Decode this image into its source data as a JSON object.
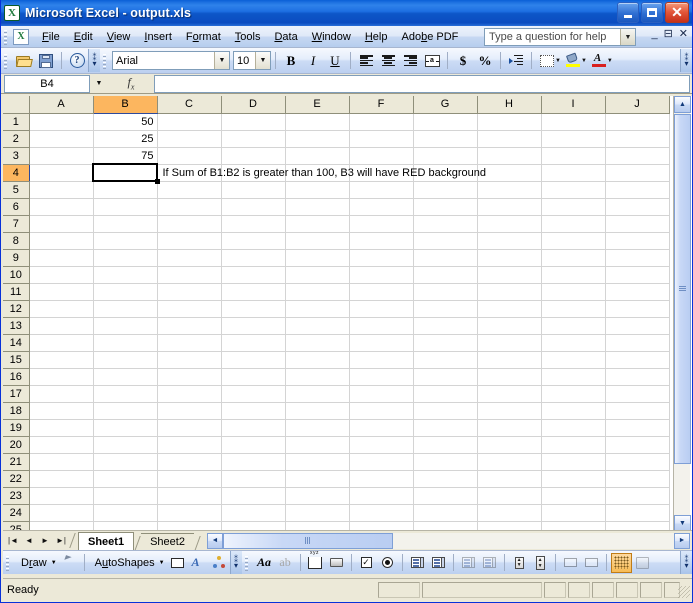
{
  "window": {
    "title": "Microsoft Excel - output.xls",
    "app_icon": "excel-icon",
    "minimize_label": "_",
    "maximize_label": "□",
    "close_label": "✕"
  },
  "menubar": {
    "items": [
      {
        "label": "File",
        "accel": "F"
      },
      {
        "label": "Edit",
        "accel": "E"
      },
      {
        "label": "View",
        "accel": "V"
      },
      {
        "label": "Insert",
        "accel": "I"
      },
      {
        "label": "Format",
        "accel": "o"
      },
      {
        "label": "Tools",
        "accel": "T"
      },
      {
        "label": "Data",
        "accel": "D"
      },
      {
        "label": "Window",
        "accel": "W"
      },
      {
        "label": "Help",
        "accel": "H"
      },
      {
        "label": "Adobe PDF",
        "accel": "b"
      }
    ],
    "ask_box_placeholder": "Type a question for help",
    "doc_minimize": "_",
    "doc_restore": "⊟",
    "doc_close": "✕"
  },
  "toolbar": {
    "open_title": "Open",
    "save_title": "Save",
    "help_title": "Microsoft Excel Help",
    "help_glyph": "?",
    "font_name": "Arial",
    "font_size": "10",
    "bold_label": "B",
    "italic_label": "I",
    "underline_label": "U",
    "align_left_title": "Align Left",
    "align_center_title": "Center",
    "align_right_title": "Align Right",
    "merge_title": "Merge and Center",
    "merge_glyph": "a",
    "currency_label": "$",
    "percent_label": "%",
    "indent_title": "Increase Indent",
    "borders_title": "Borders",
    "fill_color_title": "Fill Color",
    "fill_color": "#ffff00",
    "font_color_title": "Font Color",
    "font_color": "#d81f1f",
    "overflow_label": "»"
  },
  "formulabar": {
    "name_box_value": "B4",
    "fx_label": "fx",
    "formula_value": ""
  },
  "grid": {
    "columns": [
      "A",
      "B",
      "C",
      "D",
      "E",
      "F",
      "G",
      "H",
      "I",
      "J"
    ],
    "selected_column": "B",
    "rows": [
      "1",
      "2",
      "3",
      "4",
      "5",
      "6",
      "7",
      "8",
      "9",
      "10",
      "11",
      "12",
      "13",
      "14",
      "15",
      "16",
      "17",
      "18",
      "19",
      "20",
      "21",
      "22",
      "23",
      "24",
      "25"
    ],
    "selected_row": "4",
    "selected_cell": "B4",
    "cells": [
      {
        "ref": "B1",
        "row": 1,
        "col": "B",
        "value": "50",
        "align": "right"
      },
      {
        "ref": "B2",
        "row": 2,
        "col": "B",
        "value": "25",
        "align": "right"
      },
      {
        "ref": "B3",
        "row": 3,
        "col": "B",
        "value": "75",
        "align": "right"
      },
      {
        "ref": "C4",
        "row": 4,
        "col": "C",
        "value": "If Sum of B1:B2 is greater than 100, B3 will have RED background",
        "align": "left"
      }
    ],
    "header_selected_color": "#fcb65f"
  },
  "scrollbars": {
    "v_up": "▲",
    "v_down": "▼",
    "h_left": "◄",
    "h_right": "►"
  },
  "sheettabs": {
    "nav_first": "|◄",
    "nav_prev": "◄",
    "nav_next": "►",
    "nav_last": "►|",
    "tabs": [
      {
        "label": "Sheet1",
        "active": true
      },
      {
        "label": "Sheet2",
        "active": false
      }
    ]
  },
  "drawing_toolbar": {
    "draw_label": "Draw",
    "draw_arrow": "▼",
    "select_objects_title": "Select Objects",
    "autoshapes_label": "AutoShapes",
    "autoshapes_accel": "u",
    "autoshapes_arrow": "▼",
    "rectangle_title": "Rectangle",
    "wordart_title": "Insert WordArt",
    "wordart_glyph": "A",
    "diagram_title": "Insert Diagram or Organization Chart",
    "overflow_label": "»"
  },
  "control_toolbox": {
    "design_mode_title": "Design Mode",
    "design_glyph": "Aa",
    "properties_title": "Properties",
    "properties_glyph": "ab",
    "view_code_title": "View Code",
    "view_code_glyph": "xyz",
    "checkbox_title": "Check Box",
    "checkbox_glyph": "✓",
    "optionbutton_title": "Option Button",
    "textbox_title": "Text Box",
    "combobox_title": "Combo Box",
    "listbox_title": "List Box",
    "togglebutton_title": "Toggle Button",
    "spinbutton_title": "Spin Button",
    "scrollbar_title": "Scroll Bar",
    "label_title": "Label",
    "image_title": "Image",
    "more_controls_title": "More Controls",
    "overflow_label": "»"
  },
  "statusbar": {
    "message": "Ready"
  }
}
